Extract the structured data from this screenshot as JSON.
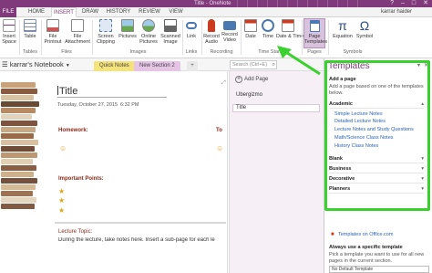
{
  "window": {
    "title": "Title - OneNote",
    "controls": [
      "?",
      "–",
      "□",
      "✕"
    ]
  },
  "ribbon_tabs": [
    "FILE",
    "HOME",
    "INSERT",
    "DRAW",
    "HISTORY",
    "REVIEW",
    "VIEW"
  ],
  "active_tab": "INSERT",
  "user_name": "karrar haider",
  "ribbon": {
    "insert_space": "Insert Space",
    "table": "Table",
    "file_printout": "File Printout",
    "file_attachment": "File Attachment",
    "screen_clipping": "Screen Clipping",
    "pictures": "Pictures",
    "online_pictures": "Online Pictures",
    "scanned_image": "Scanned Image",
    "link": "Link",
    "record_audio": "Record Audio",
    "record_video": "Record Video",
    "date": "Date",
    "time": "Time",
    "date_time": "Date & Time",
    "page_templates": "Page Templates",
    "equation": "Equation",
    "symbol": "Symbol",
    "groups": {
      "tables": "Tables",
      "files": "Files",
      "images": "Images",
      "links": "Links",
      "recording": "Recording",
      "time_stamp": "Time Stamp",
      "pages": "Pages",
      "symbols": "Symbols"
    }
  },
  "notebook": {
    "name": "karrar's Notebook",
    "sections": [
      "Quick Notes",
      "New Section 2"
    ],
    "add_section": "+",
    "search_placeholder": "Search (Ctrl+E)"
  },
  "page": {
    "title": "Title",
    "date": "Tuesday, October 27, 2015",
    "time": "6:32 PM",
    "homework_label": "Homework:",
    "todo_label": "To",
    "important_label": "Important Points:",
    "lecture_topic": "Lecture Topic:",
    "lecture_text": "During the lecture, take notes here.  Insert a sub-page for each le"
  },
  "page_list": {
    "add_page": "Add Page",
    "pages": [
      "Ubergizmo",
      "Title"
    ]
  },
  "templates": {
    "header": "Templates",
    "add_page_label": "Add a page",
    "add_page_desc": "Add a page based on one of the templates below.",
    "categories": [
      {
        "name": "Academic",
        "expanded": true,
        "items": [
          "Simple Lecture Notes",
          "Detailed Lecture Notes",
          "Lecture Notes and Study Questions",
          "Math/Science Class Notes",
          "History Class Notes"
        ]
      },
      {
        "name": "Blank",
        "expanded": false,
        "items": []
      },
      {
        "name": "Business",
        "expanded": false,
        "items": []
      },
      {
        "name": "Decorative",
        "expanded": false,
        "items": []
      },
      {
        "name": "Planners",
        "expanded": false,
        "items": []
      }
    ],
    "office_link": "Templates on Office.com",
    "always_label": "Always use a specific template",
    "always_desc": "Pick a template you want to use for all new pages in the current section.",
    "default_select": "No Default Template"
  },
  "colors": {
    "accent": "#80397b",
    "highlight": "#3ad12e",
    "link": "#2a62b8"
  }
}
